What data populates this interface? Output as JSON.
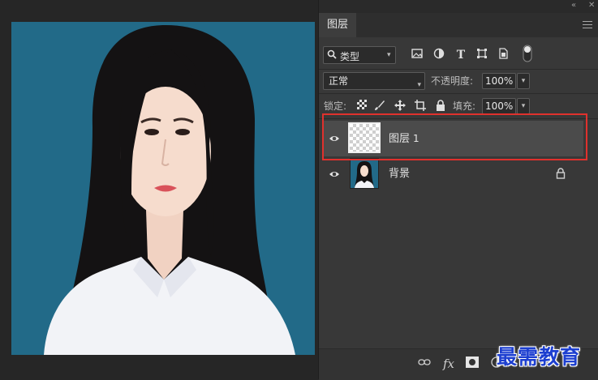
{
  "panel": {
    "collapse_glyph": "«",
    "close_glyph": "✕",
    "tab_label": "图层",
    "filter": {
      "label": "类型",
      "search_glyph": "🔍"
    },
    "filter_icons": [
      "image-filter-icon",
      "adjustment-filter-icon",
      "type-filter-icon",
      "shape-filter-icon",
      "smart-object-filter-icon",
      "filter-toggle-icon"
    ],
    "blend_mode": "正常",
    "opacity_label": "不透明度:",
    "opacity_value": "100%",
    "lock_label": "锁定:",
    "fill_label": "填充:",
    "fill_value": "100%",
    "lock_icons": [
      "lock-transparent-pixels-icon",
      "lock-image-pixels-icon",
      "lock-position-icon",
      "lock-artboard-icon",
      "lock-all-icon"
    ]
  },
  "layers": [
    {
      "name": "图层",
      "number": "1",
      "selected": true,
      "visible": true,
      "thumbnail": "transparent"
    },
    {
      "name": "背景",
      "number": "",
      "selected": false,
      "visible": true,
      "locked": true,
      "thumbnail": "portrait-photo"
    }
  ],
  "bottom_bar": {
    "icons": [
      "link-layers-icon",
      "layer-style-fx-icon",
      "add-mask-icon",
      "new-adjustment-layer-icon"
    ],
    "fx_label": "fx"
  },
  "watermark": "最需教育",
  "colors": {
    "photo_background": "#226a88",
    "panel_background": "#383838",
    "selected_row": "#4b4b4b",
    "highlight_box": "#e0312d",
    "watermark": "#1d3fd0"
  }
}
